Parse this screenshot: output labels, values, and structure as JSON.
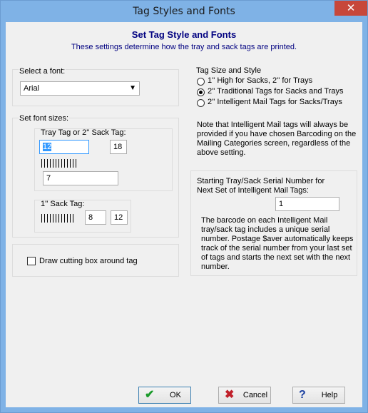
{
  "window": {
    "title": "Tag Styles and Fonts",
    "close_glyph": "✕"
  },
  "header": {
    "title": "Set Tag Style and Fonts",
    "subtitle": "These settings determine how the tray and sack tags are printed."
  },
  "font": {
    "label": "Select a font:",
    "value": "Arial"
  },
  "font_sizes": {
    "label": "Set font sizes:",
    "tray_tag": {
      "label": "Tray Tag or 2'' Sack Tag:",
      "size1": "12",
      "size2": "18",
      "barcode_size": "7"
    },
    "sack_tag": {
      "label": "1'' Sack Tag:",
      "barcode_size": "8",
      "size": "12"
    }
  },
  "cutting_box": {
    "label": "Draw cutting box around tag",
    "checked": false
  },
  "tag_style": {
    "label": "Tag Size and Style",
    "options": [
      {
        "label": "1'' High for Sacks, 2'' for Trays",
        "selected": false
      },
      {
        "label": "2'' Traditional Tags for Sacks and Trays",
        "selected": true
      },
      {
        "label": "2'' Intelligent Mail Tags for Sacks/Trays",
        "selected": false
      }
    ]
  },
  "note": {
    "lines": [
      "Note that Intelligent Mail tags will always be",
      "provided if you have chosen Barcoding on the",
      "Mailing Categories screen, regardless of the",
      "above setting."
    ]
  },
  "serial": {
    "label_lines": [
      "Starting Tray/Sack Serial Number for",
      "Next Set of Intelligent Mail Tags:"
    ],
    "value": "1",
    "description_lines": [
      "The barcode on each Intelligent Mail",
      "tray/sack tag includes a unique serial",
      "number. Postage $aver automatically keeps",
      "track of the serial number from your last set",
      "of tags and starts the next set with the next",
      "number."
    ]
  },
  "buttons": {
    "ok": {
      "label": "OK",
      "icon": "checkmark-icon",
      "color": "#1a9a2a"
    },
    "cancel": {
      "label": "Cancel",
      "icon": "x-icon",
      "color": "#c0202a"
    },
    "help": {
      "label": "Help",
      "icon": "question-icon",
      "color": "#1a3fa0"
    }
  }
}
